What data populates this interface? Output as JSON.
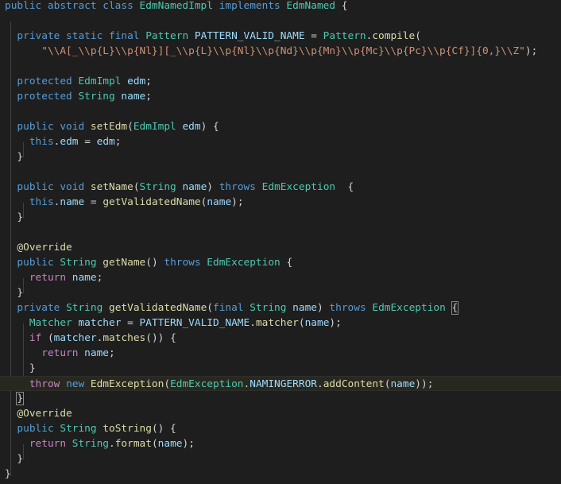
{
  "editor": {
    "lines": [
      [
        [
          "kw",
          "public abstract class "
        ],
        [
          "ty",
          "EdmNamedImpl "
        ],
        [
          "kw",
          "implements "
        ],
        [
          "ty",
          "EdmNamed"
        ],
        [
          "pun",
          " {"
        ]
      ],
      [],
      [
        [
          "pun",
          "  "
        ],
        [
          "kw",
          "private static final "
        ],
        [
          "ty",
          "Pattern "
        ],
        [
          "var",
          "PATTERN_VALID_NAME"
        ],
        [
          "pun",
          " = "
        ],
        [
          "ty",
          "Pattern"
        ],
        [
          "pun",
          "."
        ],
        [
          "fn",
          "compile"
        ],
        [
          "pun",
          "("
        ]
      ],
      [
        [
          "pun",
          "      "
        ],
        [
          "str",
          "\"\\\\A[_\\\\p{L}\\\\p{Nl}][_\\\\p{L}\\\\p{Nl}\\\\p{Nd}\\\\p{Mn}\\\\p{Mc}\\\\p{Pc}\\\\p{Cf}]{0,}\\\\Z\""
        ],
        [
          "pun",
          ");"
        ]
      ],
      [],
      [
        [
          "pun",
          "  "
        ],
        [
          "kw",
          "protected "
        ],
        [
          "ty",
          "EdmImpl "
        ],
        [
          "var",
          "edm"
        ],
        [
          "pun",
          ";"
        ]
      ],
      [
        [
          "pun",
          "  "
        ],
        [
          "kw",
          "protected "
        ],
        [
          "ty",
          "String "
        ],
        [
          "var",
          "name"
        ],
        [
          "pun",
          ";"
        ]
      ],
      [],
      [
        [
          "pun",
          "  "
        ],
        [
          "kw",
          "public void "
        ],
        [
          "fn",
          "setEdm"
        ],
        [
          "pun",
          "("
        ],
        [
          "ty",
          "EdmImpl "
        ],
        [
          "var",
          "edm"
        ],
        [
          "pun",
          ") {"
        ]
      ],
      [
        [
          "pun",
          "    "
        ],
        [
          "kw",
          "this"
        ],
        [
          "pun",
          "."
        ],
        [
          "var",
          "edm"
        ],
        [
          "pun",
          " = "
        ],
        [
          "var",
          "edm"
        ],
        [
          "pun",
          ";"
        ]
      ],
      [
        [
          "pun",
          "  }"
        ]
      ],
      [],
      [
        [
          "pun",
          "  "
        ],
        [
          "kw",
          "public void "
        ],
        [
          "fn",
          "setName"
        ],
        [
          "pun",
          "("
        ],
        [
          "ty",
          "String "
        ],
        [
          "var",
          "name"
        ],
        [
          "pun",
          ") "
        ],
        [
          "kw",
          "throws "
        ],
        [
          "ty",
          "EdmException"
        ],
        [
          "pun",
          "  {"
        ]
      ],
      [
        [
          "pun",
          "    "
        ],
        [
          "kw",
          "this"
        ],
        [
          "pun",
          "."
        ],
        [
          "var",
          "name"
        ],
        [
          "pun",
          " = "
        ],
        [
          "fn",
          "getValidatedName"
        ],
        [
          "pun",
          "("
        ],
        [
          "var",
          "name"
        ],
        [
          "pun",
          ");"
        ]
      ],
      [
        [
          "pun",
          "  }"
        ]
      ],
      [],
      [
        [
          "pun",
          "  "
        ],
        [
          "ann",
          "@Override"
        ]
      ],
      [
        [
          "pun",
          "  "
        ],
        [
          "kw",
          "public "
        ],
        [
          "ty",
          "String "
        ],
        [
          "fn",
          "getName"
        ],
        [
          "pun",
          "() "
        ],
        [
          "kw",
          "throws "
        ],
        [
          "ty",
          "EdmException"
        ],
        [
          "pun",
          " {"
        ]
      ],
      [
        [
          "pun",
          "    "
        ],
        [
          "ctl",
          "return "
        ],
        [
          "var",
          "name"
        ],
        [
          "pun",
          ";"
        ]
      ],
      [
        [
          "pun",
          "  }"
        ]
      ],
      [
        [
          "pun",
          "  "
        ],
        [
          "kw",
          "private "
        ],
        [
          "ty",
          "String "
        ],
        [
          "fn",
          "getValidatedName"
        ],
        [
          "pun",
          "("
        ],
        [
          "kw",
          "final "
        ],
        [
          "ty",
          "String "
        ],
        [
          "var",
          "name"
        ],
        [
          "pun",
          ") "
        ],
        [
          "kw",
          "throws "
        ],
        [
          "ty",
          "EdmException"
        ],
        [
          "pun",
          " "
        ],
        [
          "bm",
          "{"
        ]
      ],
      [
        [
          "pun",
          "    "
        ],
        [
          "ty",
          "Matcher "
        ],
        [
          "var",
          "matcher"
        ],
        [
          "pun",
          " = "
        ],
        [
          "var",
          "PATTERN_VALID_NAME"
        ],
        [
          "pun",
          "."
        ],
        [
          "fn",
          "matcher"
        ],
        [
          "pun",
          "("
        ],
        [
          "var",
          "name"
        ],
        [
          "pun",
          ");"
        ]
      ],
      [
        [
          "pun",
          "    "
        ],
        [
          "ctl",
          "if "
        ],
        [
          "pun",
          "("
        ],
        [
          "var",
          "matcher"
        ],
        [
          "pun",
          "."
        ],
        [
          "fn",
          "matches"
        ],
        [
          "pun",
          "()) {"
        ]
      ],
      [
        [
          "pun",
          "      "
        ],
        [
          "ctl",
          "return "
        ],
        [
          "var",
          "name"
        ],
        [
          "pun",
          ";"
        ]
      ],
      [
        [
          "pun",
          "    }"
        ]
      ],
      [
        [
          "pun",
          "    "
        ],
        [
          "ctl",
          "throw "
        ],
        [
          "kw",
          "new "
        ],
        [
          "fn",
          "EdmException"
        ],
        [
          "pun",
          "("
        ],
        [
          "ty",
          "EdmException"
        ],
        [
          "pun",
          "."
        ],
        [
          "var",
          "NAMINGERROR"
        ],
        [
          "pun",
          "."
        ],
        [
          "fn",
          "addContent"
        ],
        [
          "pun",
          "("
        ],
        [
          "var",
          "name"
        ],
        [
          "pun",
          "));"
        ]
      ],
      [
        [
          "pun",
          "  "
        ],
        [
          "bm",
          "}"
        ]
      ],
      [
        [
          "pun",
          "  "
        ],
        [
          "ann",
          "@Override"
        ]
      ],
      [
        [
          "pun",
          "  "
        ],
        [
          "kw",
          "public "
        ],
        [
          "ty",
          "String "
        ],
        [
          "fn",
          "toString"
        ],
        [
          "pun",
          "() {"
        ]
      ],
      [
        [
          "pun",
          "    "
        ],
        [
          "ctl",
          "return "
        ],
        [
          "ty",
          "String"
        ],
        [
          "pun",
          "."
        ],
        [
          "fn",
          "format"
        ],
        [
          "pun",
          "("
        ],
        [
          "var",
          "name"
        ],
        [
          "pun",
          ");"
        ]
      ],
      [
        [
          "pun",
          "  }"
        ]
      ],
      [
        [
          "pun",
          "}"
        ]
      ]
    ]
  }
}
